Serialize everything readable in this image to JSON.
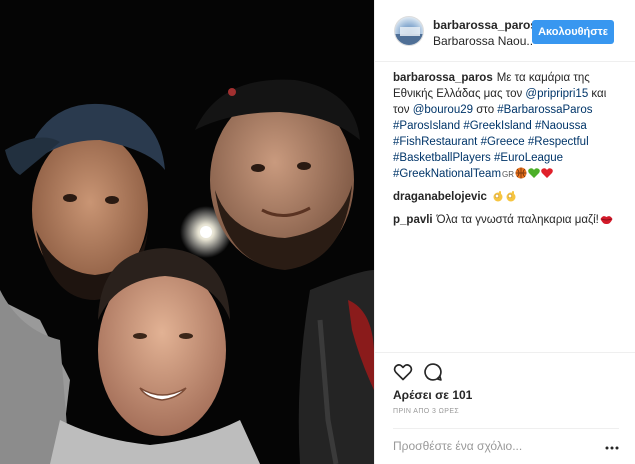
{
  "post": {
    "username": "barbarossa_paros",
    "location": "Barbarossa Naou..",
    "follow_label": "Ακολουθήστε"
  },
  "caption": {
    "user": "barbarossa_paros",
    "text_1": "Με τα καμάρια της Εθνικής Ελλάδας μας τον ",
    "mention_1": "@pripripri15",
    "text_2": " και τον ",
    "mention_2": "@bourou29",
    "text_3": " στο ",
    "hashtags": [
      "#BarbarossaParos",
      "#ParosIsland",
      "#GreekIsland",
      "#Naoussa",
      "#FishRestaurant",
      "#Greece",
      "#Respectful",
      "#BasketballPlayers",
      "#EuroLeague",
      "#GreekNationalTeam"
    ],
    "flag_text": "GR"
  },
  "comments": [
    {
      "user": "draganabelojevic",
      "text": ""
    },
    {
      "user": "p_pavli",
      "text": "Όλα τα γνωστά παληκαρια μαζί!"
    }
  ],
  "engagement": {
    "likes": "Αρέσει σε 101",
    "time": "ΠΡΙΝ ΑΠΟ 3 ΩΡΕΣ"
  },
  "comment_box": {
    "placeholder": "Προσθέστε ένα σχόλιο..."
  },
  "icons": {
    "like": "heart-outline-icon",
    "comment": "speech-bubble-icon",
    "more": "ellipsis-icon"
  },
  "colors": {
    "follow_button": "#3897f0",
    "link": "#003569",
    "muted": "#999999"
  }
}
